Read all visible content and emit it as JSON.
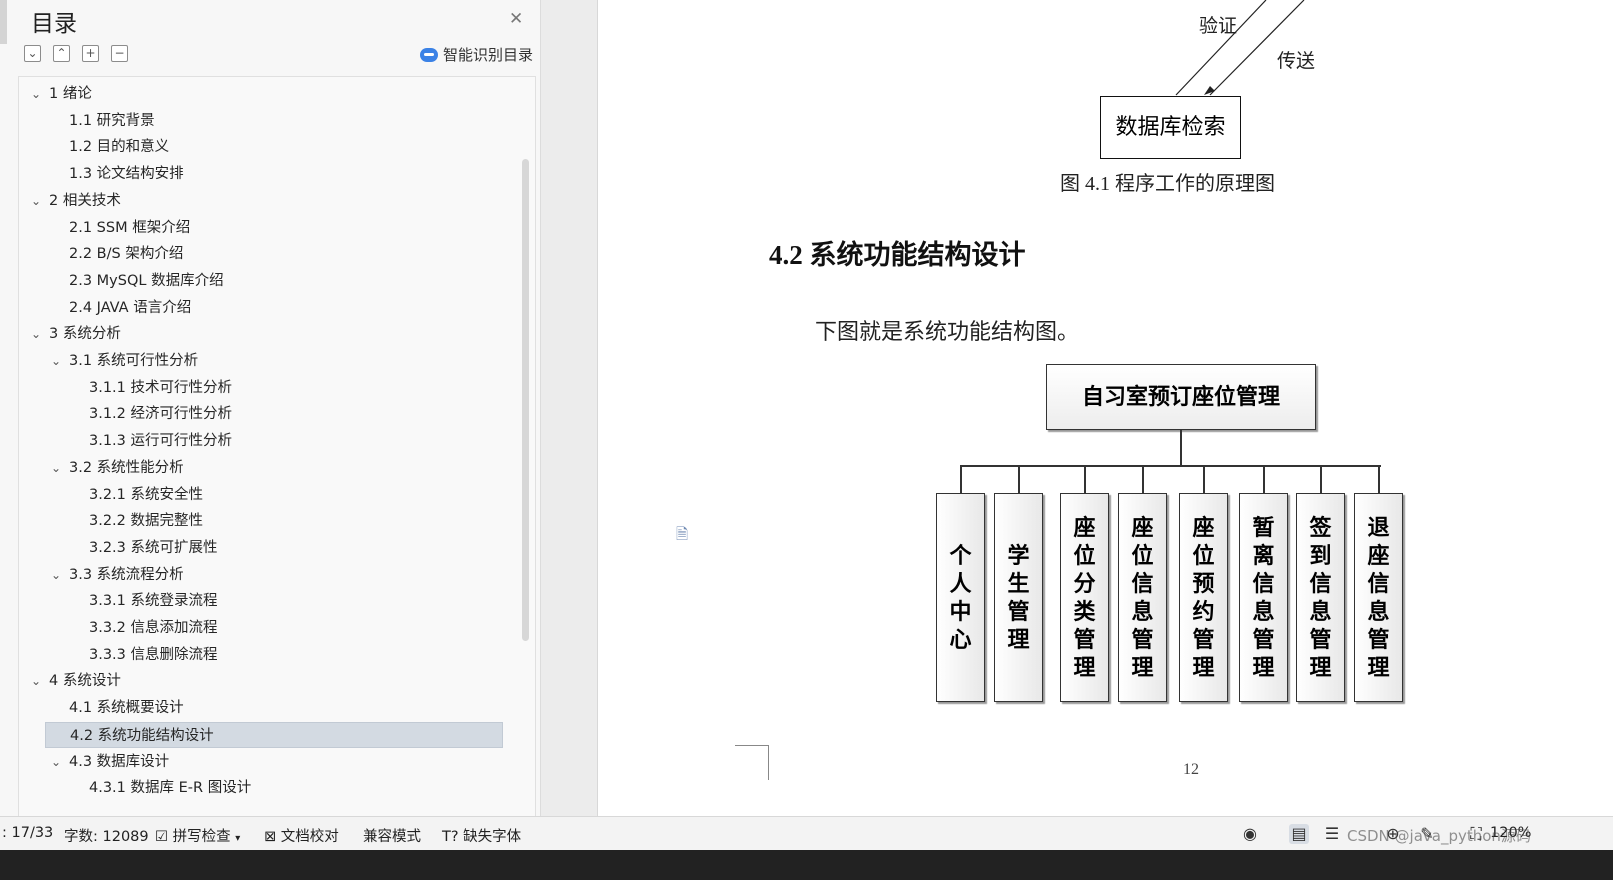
{
  "sidebar": {
    "title": "目录",
    "smart_toc_label": "智能识别目录",
    "items": [
      {
        "label": "1  绪论",
        "level": 0,
        "expanded": true
      },
      {
        "label": "1.1  研究背景",
        "level": 1
      },
      {
        "label": "1.2 目的和意义",
        "level": 1
      },
      {
        "label": "1.3  论文结构安排",
        "level": 1
      },
      {
        "label": "2  相关技术",
        "level": 0,
        "expanded": true
      },
      {
        "label": "2.1 SSM 框架介绍",
        "level": 1
      },
      {
        "label": "2.2 B/S 架构介绍",
        "level": 1
      },
      {
        "label": "2.3 MySQL 数据库介绍",
        "level": 1
      },
      {
        "label": "2.4 JAVA 语言介绍",
        "level": 1
      },
      {
        "label": "3  系统分析",
        "level": 0,
        "expanded": true
      },
      {
        "label": "3.1 系统可行性分析",
        "level": 1,
        "expanded": true
      },
      {
        "label": "3.1.1  技术可行性分析",
        "level": 2
      },
      {
        "label": "3.1.2  经济可行性分析",
        "level": 2
      },
      {
        "label": "3.1.3  运行可行性分析",
        "level": 2
      },
      {
        "label": "3.2 系统性能分析",
        "level": 1,
        "expanded": true
      },
      {
        "label": "3.2.1  系统安全性",
        "level": 2
      },
      {
        "label": "3.2.2  数据完整性",
        "level": 2
      },
      {
        "label": "3.2.3 系统可扩展性",
        "level": 2
      },
      {
        "label": "3.3 系统流程分析",
        "level": 1,
        "expanded": true
      },
      {
        "label": "3.3.1 系统登录流程",
        "level": 2
      },
      {
        "label": "3.3.2 信息添加流程",
        "level": 2
      },
      {
        "label": "3.3.3 信息删除流程",
        "level": 2
      },
      {
        "label": "4  系统设计",
        "level": 0,
        "expanded": true
      },
      {
        "label": "4.1 系统概要设计",
        "level": 1
      },
      {
        "label": "4.2 系统功能结构设计",
        "level": 1,
        "selected": true
      },
      {
        "label": "4.3 数据库设计",
        "level": 1,
        "expanded": true
      },
      {
        "label": "4.3.1 数据库 E-R 图设计",
        "level": 2
      }
    ]
  },
  "document": {
    "label_verify": "验证",
    "label_send": "传送",
    "db_box": "数据库检索",
    "figure_caption": "图 4.1  程序工作的原理图",
    "section_heading": "4.2 系统功能结构设计",
    "paragraph": "下图就是系统功能结构图。",
    "root_node": "自习室预订座位管理",
    "modules": [
      "个人中心",
      "学生管理",
      "座位分类管理",
      "座位信息管理",
      "座位预约管理",
      "暂离信息管理",
      "签到信息管理",
      "退座信息管理"
    ],
    "page_number": "12"
  },
  "status": {
    "page_info": ": 17/33",
    "word_count": "字数: 12089",
    "spell_check": "拼写检查",
    "proofread": "文档校对",
    "compat_mode": "兼容模式",
    "missing_fonts": "缺失字体",
    "zoom": "120%",
    "watermark": "CSDN @java_python源码"
  },
  "colors": {
    "selection": "#d3dae2",
    "accent": "#3b82e6"
  },
  "icons": [
    "close-icon",
    "collapse-all-icon",
    "expand-all-icon",
    "plus-icon",
    "minus-icon",
    "smart-toc-icon",
    "eye-icon",
    "page-view-icon",
    "outline-view-icon",
    "globe-icon",
    "pen-icon",
    "fullscreen-icon"
  ]
}
